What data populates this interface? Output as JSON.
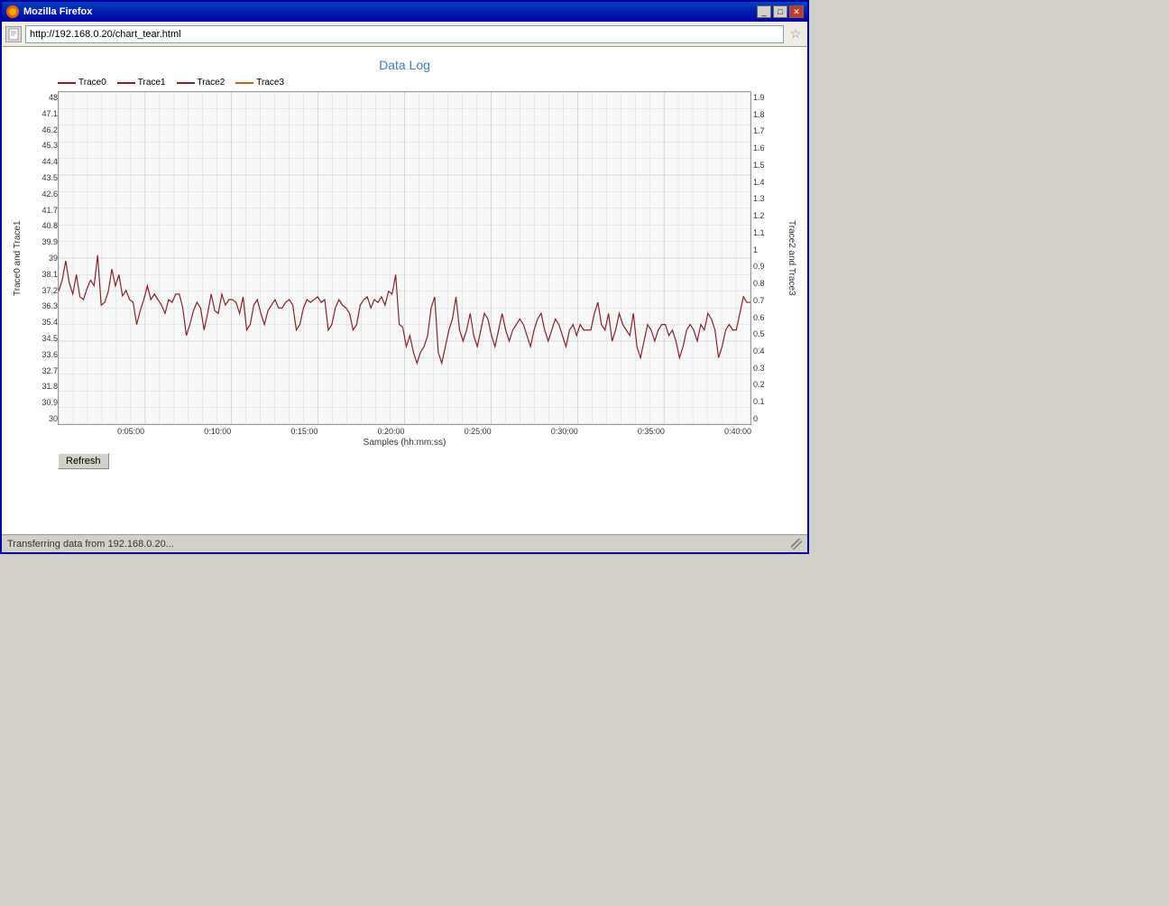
{
  "window": {
    "title": "Mozilla Firefox",
    "url": "http://192.168.0.20/chart_tear.html"
  },
  "titlebar": {
    "title_label": "Mozilla Firefox",
    "minimize_label": "_",
    "maximize_label": "□",
    "close_label": "✕"
  },
  "chart": {
    "title": "Data Log",
    "legend": [
      {
        "label": "Trace0",
        "color": "#8b2020"
      },
      {
        "label": "Trace1",
        "color": "#8b2020"
      },
      {
        "label": "Trace2",
        "color": "#8b2020"
      },
      {
        "label": "Trace3",
        "color": "#d06020"
      }
    ],
    "y_left_label": "Trace0 and Trace1",
    "y_right_label": "Trace2 and Trace3",
    "y_left_values": [
      "48",
      "47.1",
      "46.2",
      "45.3",
      "44.4",
      "43.5",
      "42.6",
      "41.7",
      "40.8",
      "39.9",
      "39",
      "38.1",
      "37.2",
      "36.3",
      "35.4",
      "34.5",
      "33.6",
      "32.7",
      "31.8",
      "30.9",
      "30"
    ],
    "y_right_values": [
      "1.9",
      "1.8",
      "1.7",
      "1.6",
      "1.5",
      "1.4",
      "1.3",
      "1.2",
      "1.1",
      "1",
      "0.9",
      "0.8",
      "0.7",
      "0.6",
      "0.5",
      "0.4",
      "0.3",
      "0.2",
      "0.1",
      "0"
    ],
    "x_values": [
      "0:05:00",
      "0:10:00",
      "0:15:00",
      "0:20:00",
      "0:25:00",
      "0:30:00",
      "0:35:00",
      "0:40:00"
    ],
    "x_label": "Samples (hh:mm:ss)"
  },
  "refresh_button": {
    "label": "Refresh"
  },
  "status_bar": {
    "text": "Transferring data from 192.168.0.20..."
  },
  "address": {
    "url": "http://192.168.0.20/chart_tear.html"
  }
}
